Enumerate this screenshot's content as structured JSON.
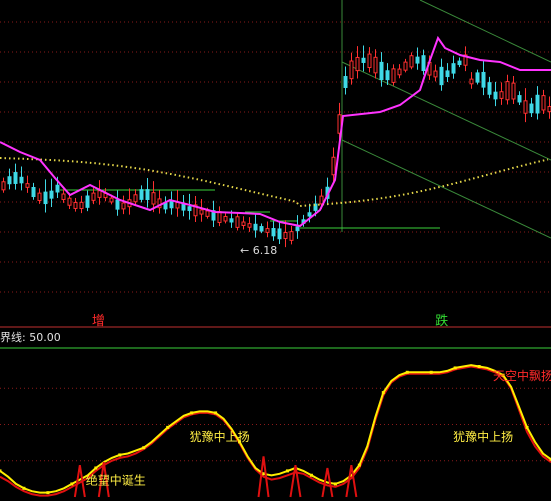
{
  "colors": {
    "bg": "#000000",
    "up": "#ff3030",
    "down": "#3fd9e6",
    "ma_fast": "#ff33ff",
    "ma_slow": "#e6d84a",
    "channel": "#3a8a3a",
    "level_line": "#3ad13a",
    "grid": "#8a1a1a",
    "osc_red": "#e01010",
    "osc_yellow": "#ffee00",
    "text_yellow": "#ffee44",
    "text_red": "#ff2a2a",
    "text_green": "#33dd33"
  },
  "chart_data": {
    "type": "candlestick",
    "upper": {
      "low_marker": "6.18",
      "signals": [
        {
          "label": "增",
          "index": 12
        },
        {
          "label": "跌",
          "index": 55
        }
      ]
    },
    "lower": {
      "header": "界线: 50.00",
      "threshold": 50,
      "ylim": [
        0,
        100
      ],
      "annotations": [
        {
          "text": "绝望中诞生",
          "x_index": 14,
          "y": 6,
          "color_key": "text_yellow"
        },
        {
          "text": "犹豫中上扬",
          "x_index": 27,
          "y": 36,
          "color_key": "text_yellow"
        },
        {
          "text": "犹豫中上扬",
          "x_index": 60,
          "y": 36,
          "color_key": "text_yellow"
        },
        {
          "text": "天空中飘扬",
          "x_index": 65,
          "y": 78,
          "color_key": "text_red"
        }
      ],
      "yellow": [
        18,
        14,
        9,
        6,
        4,
        3,
        3,
        4,
        6,
        9,
        12,
        15,
        20,
        24,
        27,
        29,
        30,
        32,
        34,
        38,
        43,
        48,
        52,
        56,
        58,
        59,
        59,
        58,
        54,
        47,
        38,
        28,
        20,
        16,
        15,
        16,
        18,
        20,
        18,
        15,
        12,
        10,
        9,
        11,
        15,
        22,
        35,
        55,
        72,
        80,
        84,
        86,
        86,
        86,
        86,
        86,
        87,
        89,
        90,
        91,
        90,
        89,
        87,
        84,
        76,
        62,
        48,
        38,
        30,
        26
      ],
      "red": [
        14,
        11,
        7,
        4,
        2,
        1,
        1,
        2,
        4,
        7,
        10,
        13,
        18,
        22,
        25,
        27,
        28,
        30,
        33,
        37,
        42,
        47,
        51,
        55,
        57,
        58,
        58,
        57,
        53,
        46,
        37,
        27,
        19,
        14,
        12,
        13,
        15,
        17,
        16,
        13,
        10,
        8,
        7,
        9,
        13,
        20,
        33,
        53,
        70,
        79,
        83,
        85,
        85,
        85,
        85,
        85,
        86,
        88,
        89,
        90,
        89,
        88,
        86,
        83,
        75,
        60,
        45,
        35,
        28,
        24
      ],
      "spikes": [
        {
          "index": 10,
          "value": 22
        },
        {
          "index": 13,
          "value": 24
        },
        {
          "index": 33,
          "value": 28
        },
        {
          "index": 37,
          "value": 22
        },
        {
          "index": 41,
          "value": 20
        },
        {
          "index": 44,
          "value": 22
        }
      ]
    }
  }
}
